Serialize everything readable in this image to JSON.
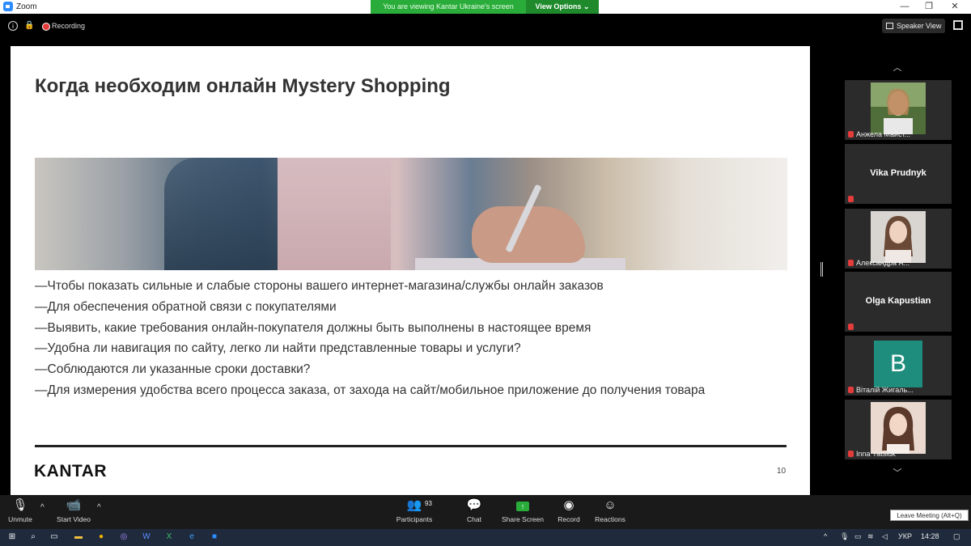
{
  "window": {
    "title": "Zoom"
  },
  "share_banner": {
    "text": "You are viewing Kantar Ukraine's screen",
    "view_options": "View Options ⌄"
  },
  "window_controls": {
    "minimize": "—",
    "maximize": "❐",
    "close": "✕"
  },
  "infobar": {
    "recording_label": "Recording",
    "speaker_view": "Speaker View"
  },
  "slide": {
    "title": "Когда необходим онлайн Mystery Shopping",
    "bullets": [
      "Чтобы показать сильные и слабые стороны вашего интернет-магазина/службы онлайн заказов",
      "Для обеспечения обратной связи с покупателями",
      "Выявить, какие требования онлайн-покупателя должны быть выполнены в настоящее время",
      "Удобна ли навигация по сайту, легко ли найти представленные товары и услуги?",
      "Соблюдаются ли указанные сроки доставки?",
      "Для измерения удобства всего процесса заказа, от захода на сайт/мобильное приложение до получения товара"
    ],
    "logo": "KANTAR",
    "page_number": "10"
  },
  "participants": [
    {
      "name": "Анжела Майст...",
      "type": "video"
    },
    {
      "name": "Vika Prudnyk",
      "type": "name"
    },
    {
      "name": "Александра А...",
      "type": "video"
    },
    {
      "name": "Olga Kapustian",
      "type": "name"
    },
    {
      "name": "Віталій Жигаль...",
      "type": "avatar",
      "initial": "B"
    },
    {
      "name": "Inna Yatsiuk",
      "type": "video"
    }
  ],
  "thumb_nav": {
    "up": "︿",
    "down": "﹀"
  },
  "toolbar": {
    "unmute": "Unmute",
    "start_video": "Start Video",
    "participants": "Participants",
    "participants_count": "93",
    "chat": "Chat",
    "share_screen": "Share Screen",
    "record": "Record",
    "reactions": "Reactions",
    "caret": "^"
  },
  "tooltip": {
    "leave": "Leave Meeting (Alt+Q)"
  },
  "taskbar": {
    "language": "УКР",
    "time": "14:28"
  },
  "colors": {
    "zoom_blue": "#2d8cff",
    "share_green": "#2aac3a",
    "mute_red": "#e43b3b",
    "avatar_teal": "#1e8d7d"
  }
}
